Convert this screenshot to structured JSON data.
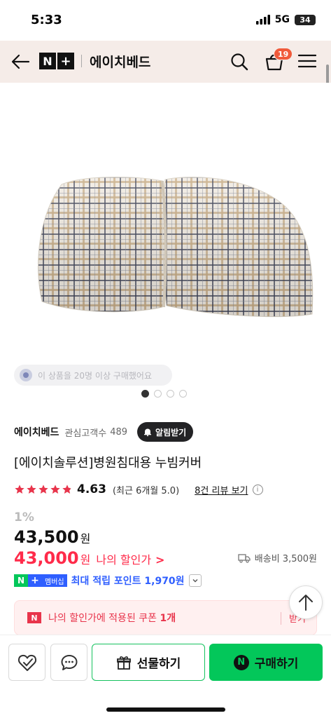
{
  "status_bar": {
    "time": "5:33",
    "network": "5G",
    "battery": "34"
  },
  "header": {
    "logo_n": "N",
    "logo_plus": "+",
    "store_name": "에이치베드",
    "cart_count": "19",
    "icons": [
      "back-arrow-icon",
      "search-icon",
      "cart-icon",
      "menu-icon"
    ]
  },
  "gallery": {
    "purchase_notice": "이 상품을 20명 이상 구매했어요",
    "dot_count": 4,
    "active_dot": 1
  },
  "seller": {
    "name": "에이치베드",
    "follower_label": "관심고객수",
    "follower_count": "489",
    "alarm_label": "알림받기"
  },
  "product": {
    "title": "[에이치솔루션]병원침대용 누빔커버",
    "rating": "4.63",
    "rating_note": "(최근 6개월 5.0)",
    "review_link": "8건 리뷰 보기",
    "star_fraction": 0.93
  },
  "price": {
    "discount_rate": "1%",
    "original": "43,500",
    "original_unit": "원",
    "my_price": "43,000",
    "my_price_unit": "원",
    "my_price_label": "나의 할인가",
    "my_price_chevron": ">",
    "shipping": "배송비 3,500원"
  },
  "membership": {
    "n_badge": "N",
    "plus_badge": "+",
    "label": "멤버십",
    "points_text": "최대 적립 포인트 1,970원"
  },
  "coupon": {
    "badge": "N",
    "text_prefix": "나의 할인가에 적용된 쿠폰",
    "text_count": "1개",
    "get_label": "받기"
  },
  "bottom_bar": {
    "gift_label": "선물하기",
    "buy_label": "구매하기",
    "buy_badge": "N"
  },
  "colors": {
    "header_bg": "#f5ece8",
    "brand_green": "#03c75a",
    "price_red": "#ff2b4a",
    "membership_blue": "#2f5fff",
    "star_red": "#e8344b"
  }
}
